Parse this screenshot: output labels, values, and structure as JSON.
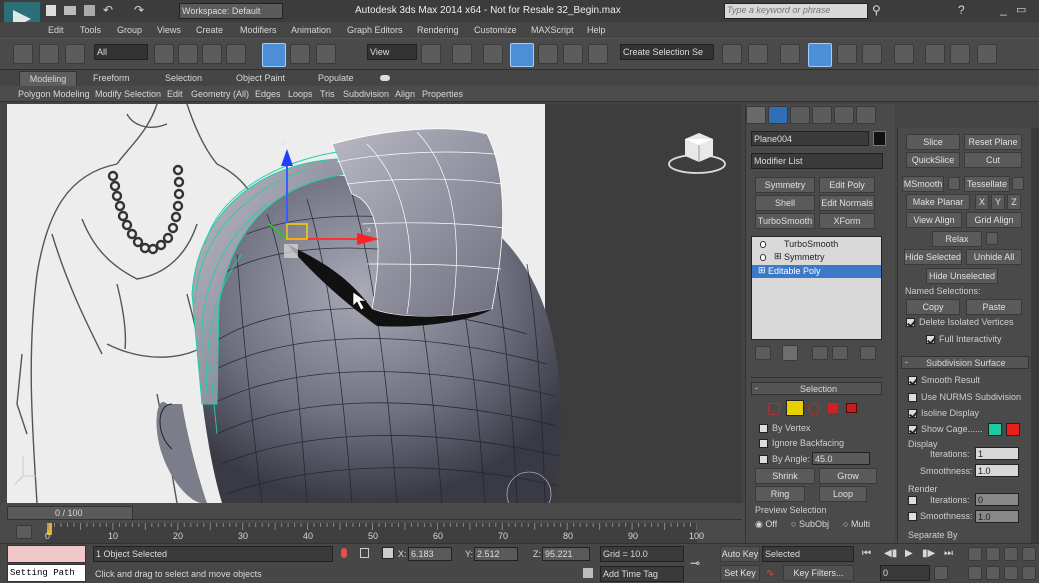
{
  "title_bar": {
    "workspace": "Workspace: Default",
    "app_title": "Autodesk 3ds Max  2014 x64   - Not for Resale    32_Begin.max",
    "search_placeholder": "Type a keyword or phrase"
  },
  "menu": [
    "Edit",
    "Tools",
    "Group",
    "Views",
    "Create",
    "Modifiers",
    "Animation",
    "Graph Editors",
    "Rendering",
    "Customize",
    "MAXScript",
    "Help"
  ],
  "toolbar": {
    "selection_filter": "All",
    "view_dropdown": "View",
    "named_selection": "Create Selection Se"
  },
  "ribbon": {
    "tabs": [
      "Modeling",
      "Freeform",
      "Selection",
      "Object Paint",
      "Populate"
    ],
    "items": [
      "Polygon Modeling",
      "Modify Selection",
      "Edit",
      "Geometry (All)",
      "Edges",
      "Loops",
      "Tris",
      "Subdivision",
      "Align",
      "Properties"
    ]
  },
  "command_panel": {
    "object_name": "Plane004",
    "modifier_list": "Modifier List",
    "modifier_buttons": [
      "Symmetry",
      "Edit Poly",
      "Shell",
      "Edit Normals",
      "TurboSmooth",
      "XForm"
    ],
    "stack": [
      "TurboSmooth",
      "Symmetry",
      "Editable Poly"
    ],
    "selection_header": "Selection",
    "by_vertex": "By Vertex",
    "ignore_backfacing": "Ignore Backfacing",
    "by_angle": "By Angle:",
    "angle_value": "45.0",
    "shrink": "Shrink",
    "grow": "Grow",
    "ring": "Ring",
    "loop": "Loop",
    "preview_selection": "Preview Selection",
    "preview_options": [
      "Off",
      "SubObj",
      "Multi"
    ]
  },
  "right_panel": {
    "top_buttons": [
      [
        "Slice",
        "Reset Plane"
      ],
      [
        "QuickSlice",
        "Cut"
      ]
    ],
    "msmooth": "MSmooth",
    "tessellate": "Tessellate",
    "make_planar": "Make Planar",
    "xyz": [
      "X",
      "Y",
      "Z"
    ],
    "view_align": "View Align",
    "grid_align": "Grid Align",
    "relax": "Relax",
    "hide_selected": "Hide Selected",
    "unhide_all": "Unhide All",
    "hide_unselected": "Hide Unselected",
    "named_selections": "Named Selections:",
    "copy": "Copy",
    "paste": "Paste",
    "delete_isolated": "Delete Isolated Vertices",
    "full_interactivity": "Full Interactivity",
    "subdivision_surface": "Subdivision Surface",
    "smooth_result": "Smooth Result",
    "use_nurms": "Use NURMS Subdivision",
    "isoline_display": "Isoline Display",
    "show_cage": "Show Cage......",
    "display": "Display",
    "iterations": "Iterations:",
    "iterations_value": "1",
    "smoothness": "Smoothness:",
    "smoothness_value": "1.0",
    "render": "Render",
    "r_iterations_value": "0",
    "r_smoothness_value": "1.0",
    "separate_by": "Separate By",
    "colors": {
      "cage1": "#1ec8a0",
      "cage2": "#e8201a"
    }
  },
  "timeline": {
    "frame": "0 / 100",
    "ticks": [
      "0",
      "10",
      "20",
      "30",
      "40",
      "50",
      "60",
      "70",
      "80",
      "90",
      "100"
    ]
  },
  "status": {
    "script_label": "Setting Path",
    "selected": "1 Object Selected",
    "hint": "Click and drag to select and move objects",
    "x_label": "X:",
    "x": "6.183",
    "y_label": "Y:",
    "y": "2.512",
    "z_label": "Z:",
    "z": "95.221",
    "grid": "Grid = 10.0",
    "add_time_tag": "Add Time Tag",
    "auto_key": "Auto Key",
    "set_key": "Set Key",
    "key_mode": "Selected",
    "key_filters": "Key Filters...",
    "current_frame": "0"
  }
}
